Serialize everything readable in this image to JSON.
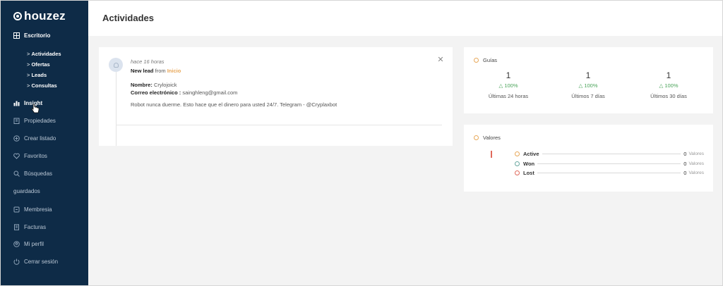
{
  "brand": {
    "logo_text": "houzez"
  },
  "sidebar": {
    "escritorio": {
      "label": "Escritorio",
      "icon": "dashboard-icon"
    },
    "sub_items": [
      "Actividades",
      "Ofertas",
      "Leads",
      "Consultas"
    ],
    "items": [
      {
        "label": "Insight",
        "icon": "bar-chart-icon"
      },
      {
        "label": "Propiedades",
        "icon": "building-icon"
      },
      {
        "label": "Crear listado",
        "icon": "plus-circle-icon"
      },
      {
        "label": "Favoritos",
        "icon": "heart-icon"
      },
      {
        "label": "Búsquedas",
        "icon": "search-icon"
      },
      {
        "label": "guardados",
        "icon": ""
      },
      {
        "label": "Membresia",
        "icon": "membership-icon"
      },
      {
        "label": "Facturas",
        "icon": "invoice-icon"
      },
      {
        "label": "Mi perfil",
        "icon": "user-icon"
      },
      {
        "label": "Cerrar sesión",
        "icon": "logout-icon"
      }
    ]
  },
  "header": {
    "title": "Actividades"
  },
  "activity": {
    "time": "hace 16 horas",
    "title_bold": "New lead",
    "title_from": "from",
    "title_link": "Inicio",
    "nombre_label": "Nombre:",
    "nombre_value": "Crylojoick",
    "email_label": "Correo electrónico :",
    "email_value": "sainghleng@gmail.com",
    "message": "Robot nunca duerme. Esto hace que el dinero para usted 24/7. Telegram - @Cryplaxbot"
  },
  "guias": {
    "title": "Guías",
    "stats": [
      {
        "value": "1",
        "change": "△ 100%",
        "label": "Últimas 24 horas"
      },
      {
        "value": "1",
        "change": "△ 100%",
        "label": "Últimos 7 días"
      },
      {
        "value": "1",
        "change": "△ 100%",
        "label": "Últimos 30 días"
      }
    ]
  },
  "valores": {
    "title": "Valores",
    "rows": [
      {
        "name": "Active",
        "value": "0",
        "unit": "Valores",
        "color": "#e8a85a"
      },
      {
        "name": "Won",
        "value": "0",
        "unit": "Valores",
        "color": "#6aa8a0"
      },
      {
        "name": "Lost",
        "value": "0",
        "unit": "Valores",
        "color": "#e06a5c"
      }
    ]
  },
  "colors": {
    "sidebar": "#0e2b47",
    "accent": "#e8a85a",
    "positive": "#4aa45a"
  }
}
